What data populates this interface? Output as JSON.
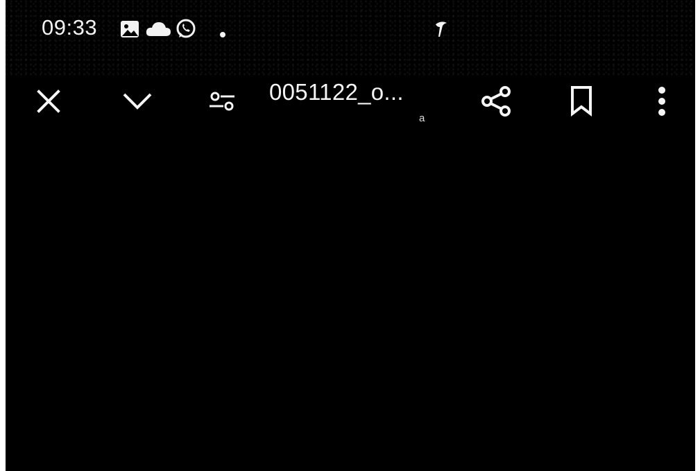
{
  "status_bar": {
    "time": "09:33",
    "icons": [
      "gallery-icon",
      "cloud-icon",
      "whatsapp-icon",
      "notification-dot-icon",
      "bird-logo-icon"
    ]
  },
  "toolbar": {
    "document_title": "0051122_o...",
    "document_subtitle": "a",
    "actions": [
      "close-icon",
      "chevron-down-icon",
      "filter-settings-icon",
      "share-icon",
      "bookmark-icon",
      "more-vert-icon"
    ]
  },
  "colors": {
    "background": "#000000",
    "foreground": "#ffffff"
  }
}
